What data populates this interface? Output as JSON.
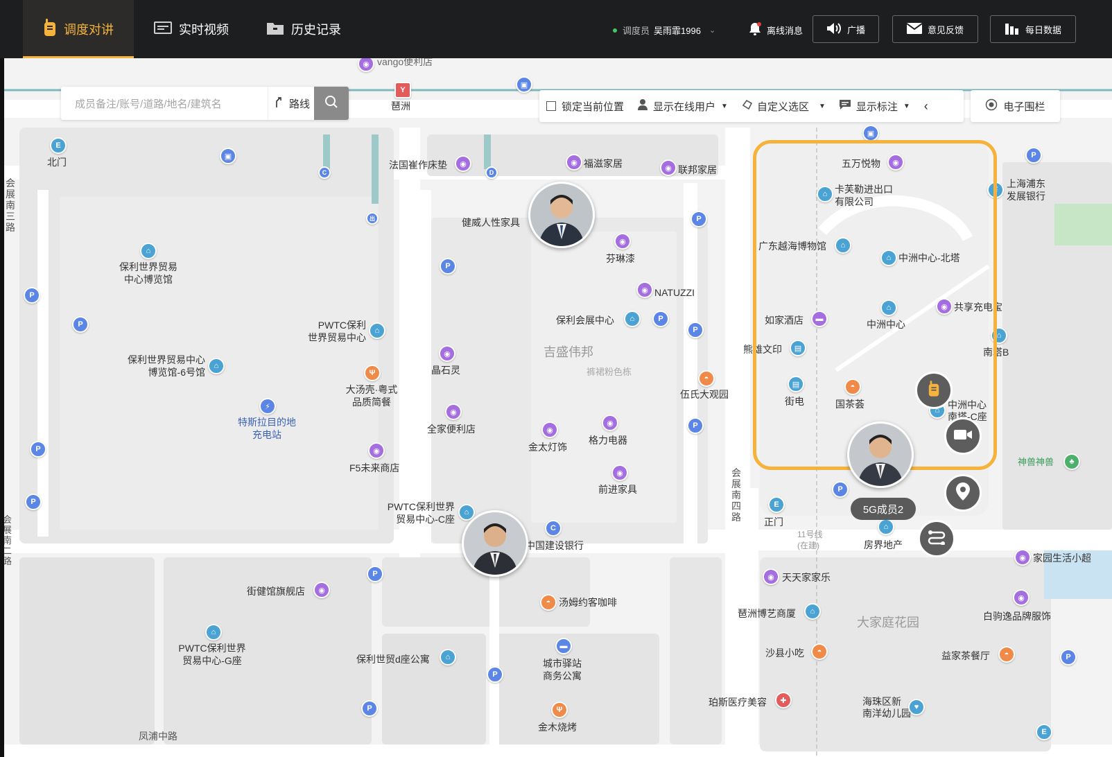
{
  "nav": {
    "tabs": [
      {
        "label": "调度对讲",
        "icon": "walkie-talkie-icon"
      },
      {
        "label": "实时视频",
        "icon": "video-screen-icon"
      },
      {
        "label": "历史记录",
        "icon": "folder-icon"
      }
    ]
  },
  "header": {
    "dispatcher_role": "调度员",
    "dispatcher_name": "吴雨霏1996",
    "offline_messages": "离线消息",
    "broadcast": "广播",
    "feedback": "意见反馈",
    "daily_data": "每日数据"
  },
  "search": {
    "placeholder": "成员备注/账号/道路/地名/建筑名",
    "route_label": "路线"
  },
  "toolbar": {
    "lock_position": "锁定当前位置",
    "show_online": "显示在线用户",
    "custom_select": "自定义选区",
    "show_markers": "显示标注",
    "geofence": "电子围栏"
  },
  "member": {
    "label": "5G成员2"
  },
  "map": {
    "areas": [
      "吉盛伟邦",
      "大家庭花园"
    ],
    "subareas": [
      "裤裙粉色栋"
    ],
    "streets": [
      "会展南三路",
      "会展南四路",
      "凤浦中路",
      "会展南二路",
      "11号线",
      "(在建)"
    ],
    "pois": {
      "vango": "vango便利店",
      "pazhou": "琶洲",
      "beimen": "北门",
      "faguo": "法国崔作床垫",
      "fuzi": "福滋家居",
      "lianbang": "联邦家居",
      "jianwei": "健威人性家具",
      "fenlinqi": "芬琳漆",
      "natuzzi": "NATUZZI",
      "baoli_expo_1": "保利世界贸易",
      "baoli_expo_2": "中心博览馆",
      "pwtc_1": "PWTC保利",
      "pwtc_2": "世界贸易中心",
      "baoli_conf": "保利会展中心",
      "expo6_1": "保利世界贸易中心",
      "expo6_2": "博览馆-6号馆",
      "jingshiling": "晶石灵",
      "datang_1": "大汤壳·粤式",
      "datang_2": "品质简餐",
      "tesla_1": "特斯拉目的地",
      "tesla_2": "充电站",
      "quanjia": "全家便利店",
      "jintai": "金太灯饰",
      "geli": "格力电器",
      "f5": "F5未来商店",
      "qianjin": "前进家具",
      "pwtcc_1": "PWTC保利世界",
      "pwtcc_2": "贸易中心-C座",
      "ccb": "中国建设银行",
      "jiejian": "街健馆旗舰店",
      "tom": "汤姆约客咖啡",
      "pwtcg_1": "PWTC保利世界",
      "pwtcg_2": "贸易中心-G座",
      "baolid": "保利世贸d座公寓",
      "chengshi_1": "城市驿站",
      "chengshi_2": "商务公寓",
      "jinmu": "金木烧烤",
      "wushi": "伍氏大观园",
      "wanyue": "五万悦物",
      "kafu_1": "卡芙勒进出口",
      "kafu_2": "有限公司",
      "yuehai": "广东越海博物馆",
      "zzbei": "中洲中心-北塔",
      "rujia": "如家酒店",
      "zz": "中洲中心",
      "gongxiang": "共享充电宝",
      "xiongwen": "熊雄文印",
      "nanta": "南塔B",
      "jiedian": "街电",
      "guocha": "国茶荟",
      "zzc_1": "中洲中心",
      "zzc_2": "南塔-C座",
      "spdb_1": "上海浦东",
      "spdb_2": "发展银行",
      "shenshou": "神兽神兽",
      "zhengmen": "正门",
      "fangjie": "房界地产",
      "tiantian": "天天家家乐",
      "jiayuan": "家园生活小超",
      "pazhou_art": "琶洲博艺商厦",
      "shaxian": "沙县小吃",
      "baiju": "白驹逸品牌服饰",
      "yijia": "益家茶餐厅",
      "pasi": "珀斯医疗美容",
      "haizhu_1": "海珠区新",
      "haizhu_2": "南洋幼儿园"
    }
  }
}
